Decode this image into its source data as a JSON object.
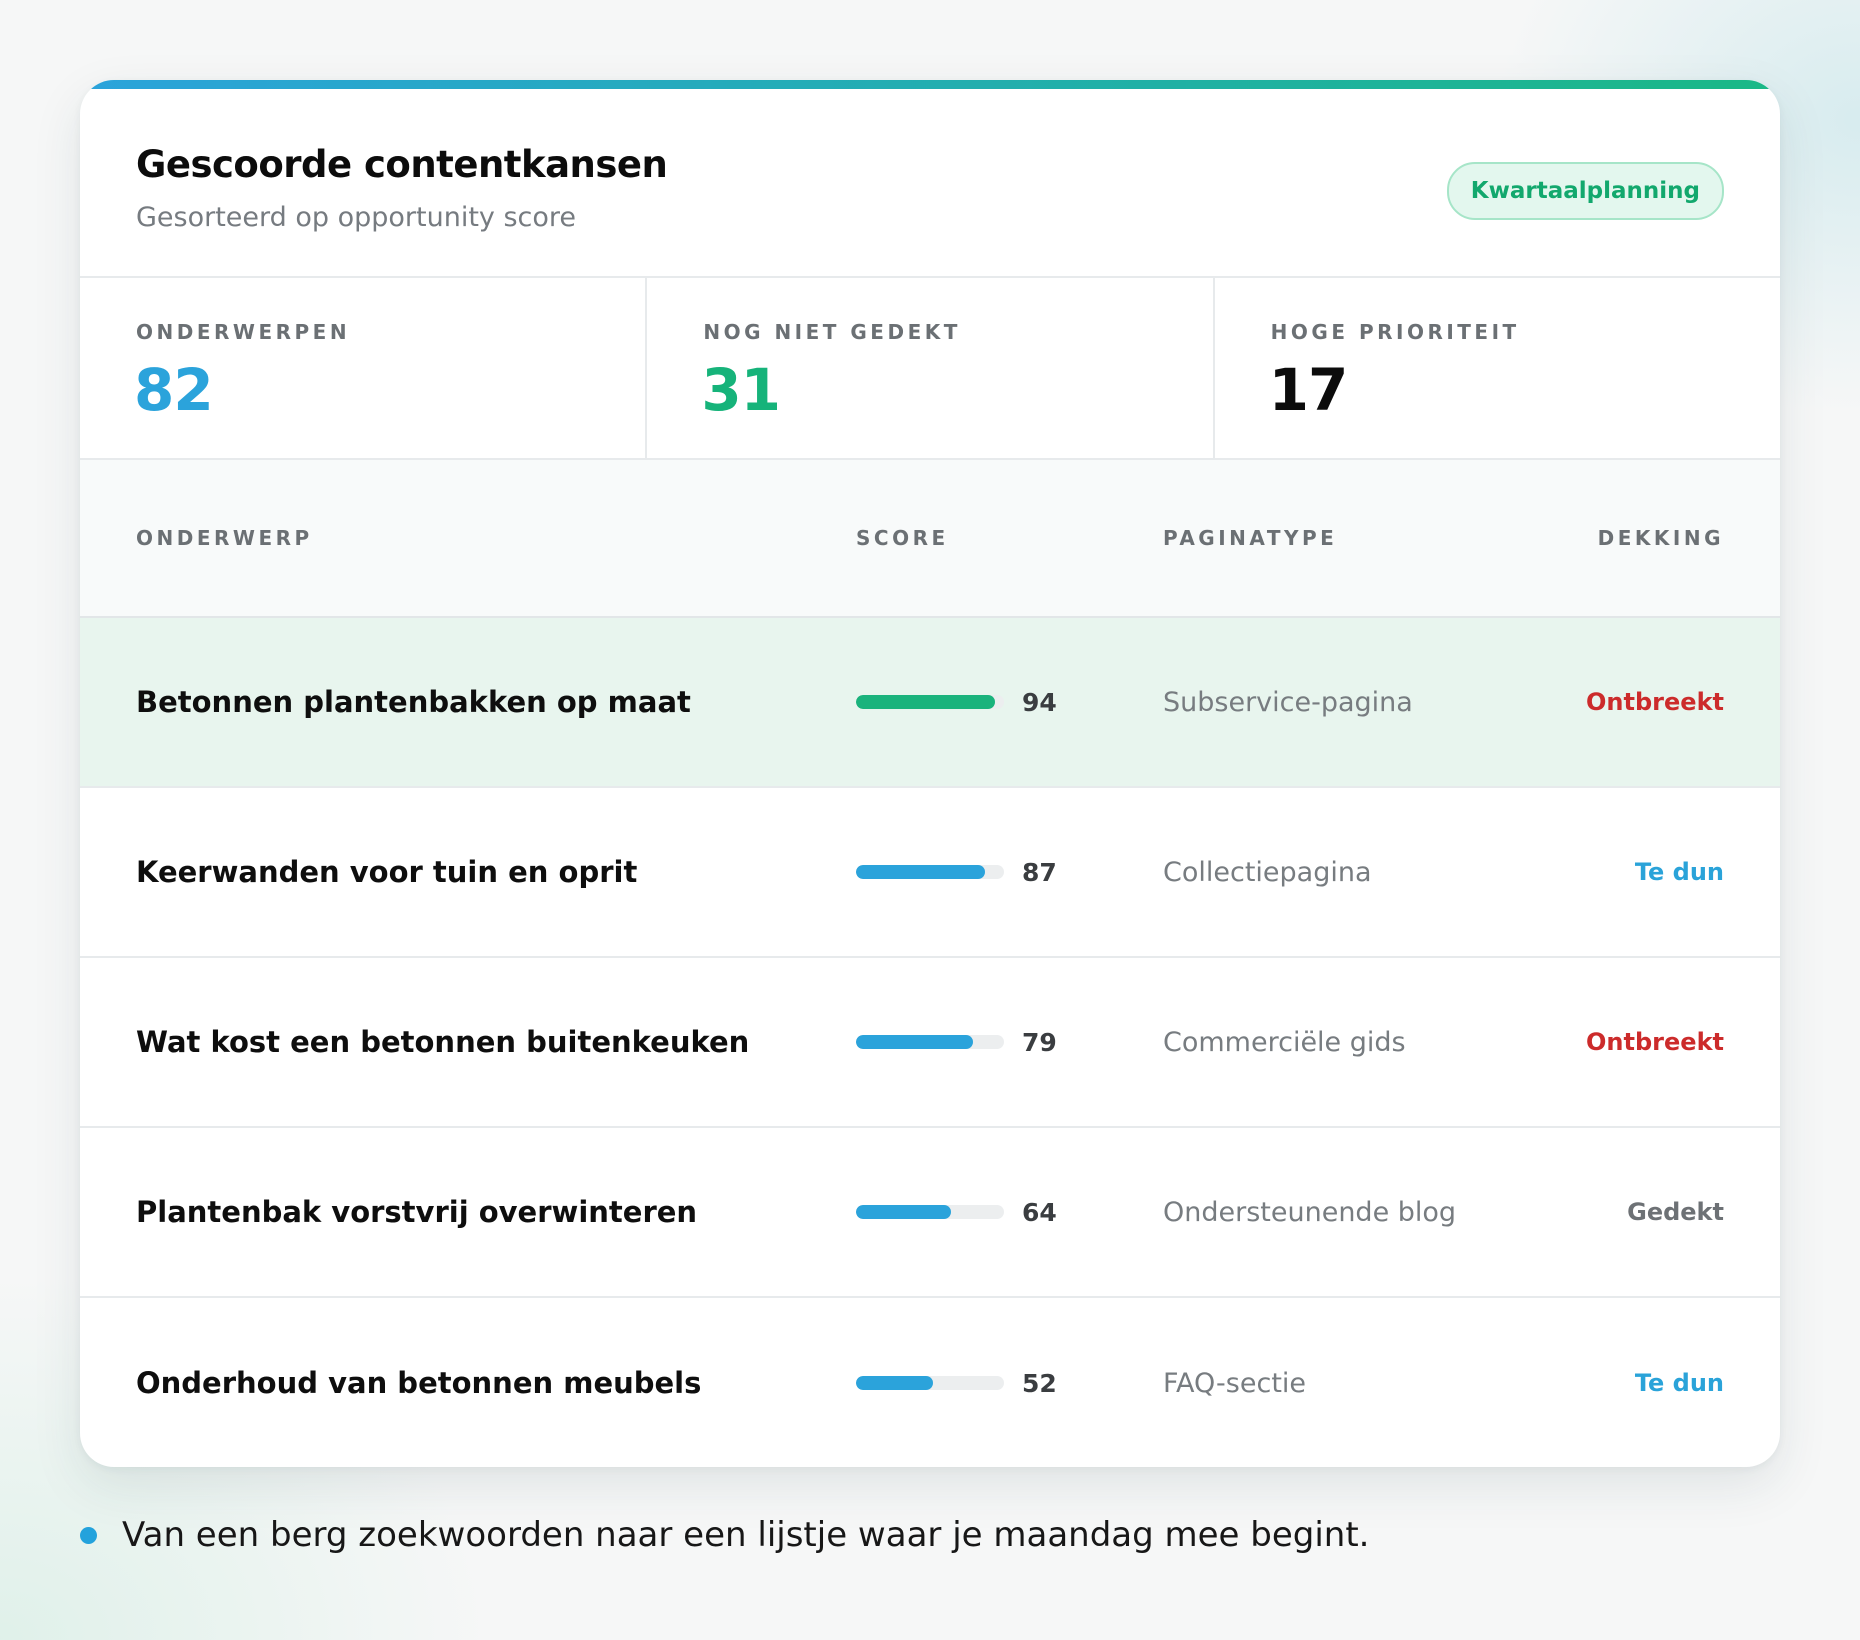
{
  "card": {
    "title": "Gescoorde contentkansen",
    "subtitle": "Gesorteerd op opportunity score",
    "badge": "Kwartaalplanning"
  },
  "stats": [
    {
      "label": "ONDERWERPEN",
      "value": "82",
      "color": "#2ba3db"
    },
    {
      "label": "NOG NIET GEDEKT",
      "value": "31",
      "color": "#16b37a"
    },
    {
      "label": "HOGE PRIORITEIT",
      "value": "17",
      "color": "#0c0c0c"
    }
  ],
  "table": {
    "headers": {
      "topic": "ONDERWERP",
      "score": "SCORE",
      "type": "PAGINATYPE",
      "coverage": "DEKKING"
    },
    "rows": [
      {
        "topic": "Betonnen plantenbakken op maat",
        "score": 94,
        "score_label": "94",
        "page_type": "Subservice-pagina",
        "coverage": "Ontbreekt",
        "coverage_color": "#cc2b2b",
        "bar_color": "#1ab37c",
        "highlighted": true
      },
      {
        "topic": "Keerwanden voor tuin en oprit",
        "score": 87,
        "score_label": "87",
        "page_type": "Collectiepagina",
        "coverage": "Te dun",
        "coverage_color": "#2aa3d9",
        "bar_color": "#2ba3db",
        "highlighted": false
      },
      {
        "topic": "Wat kost een betonnen buitenkeuken",
        "score": 79,
        "score_label": "79",
        "page_type": "Commerciële gids",
        "coverage": "Ontbreekt",
        "coverage_color": "#cc2b2b",
        "bar_color": "#2ba3db",
        "highlighted": false
      },
      {
        "topic": "Plantenbak vorstvrij overwinteren",
        "score": 64,
        "score_label": "64",
        "page_type": "Ondersteunende blog",
        "coverage": "Gedekt",
        "coverage_color": "#6d7175",
        "bar_color": "#2ba3db",
        "highlighted": false
      },
      {
        "topic": "Onderhoud van betonnen meubels",
        "score": 52,
        "score_label": "52",
        "page_type": "FAQ-sectie",
        "coverage": "Te dun",
        "coverage_color": "#2aa3d9",
        "bar_color": "#2ba3db",
        "highlighted": false
      }
    ]
  },
  "footnote": "Van een berg zoekwoorden naar een lijstje waar je maandag mee begint."
}
